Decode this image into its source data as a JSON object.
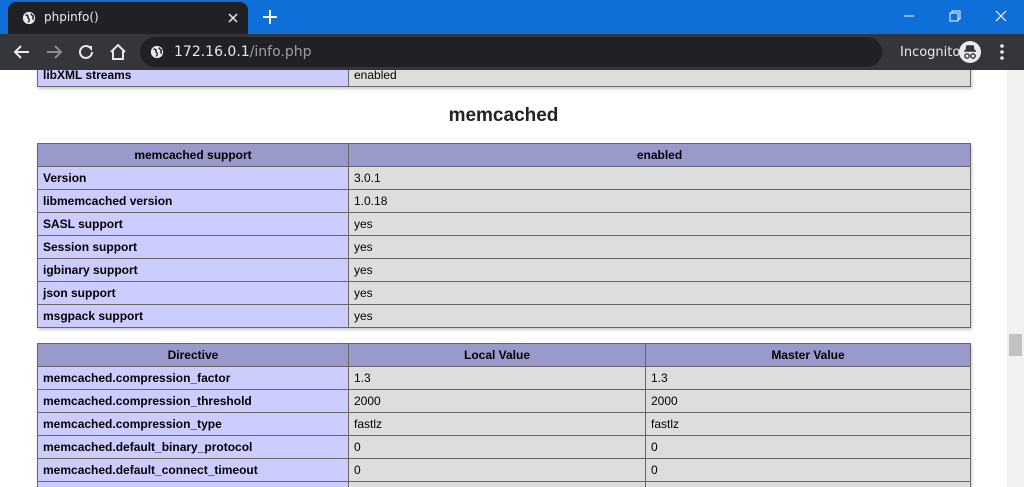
{
  "browser": {
    "tab_title": "phpinfo()",
    "url_host": "172.16.0.1",
    "url_path": "/info.php",
    "incognito_label": "Incognito"
  },
  "top_table": {
    "rows": [
      {
        "key": "libXML streams",
        "value": "enabled"
      }
    ]
  },
  "section_title": "memcached",
  "support_table": {
    "header": {
      "key": "memcached support",
      "value": "enabled"
    },
    "rows": [
      {
        "key": "Version",
        "value": "3.0.1"
      },
      {
        "key": "libmemcached version",
        "value": "1.0.18"
      },
      {
        "key": "SASL support",
        "value": "yes"
      },
      {
        "key": "Session support",
        "value": "yes"
      },
      {
        "key": "igbinary support",
        "value": "yes"
      },
      {
        "key": "json support",
        "value": "yes"
      },
      {
        "key": "msgpack support",
        "value": "yes"
      }
    ]
  },
  "directive_table": {
    "headers": [
      "Directive",
      "Local Value",
      "Master Value"
    ],
    "rows": [
      {
        "directive": "memcached.compression_factor",
        "local": "1.3",
        "master": "1.3"
      },
      {
        "directive": "memcached.compression_threshold",
        "local": "2000",
        "master": "2000"
      },
      {
        "directive": "memcached.compression_type",
        "local": "fastlz",
        "master": "fastlz"
      },
      {
        "directive": "memcached.default_binary_protocol",
        "local": "0",
        "master": "0"
      },
      {
        "directive": "memcached.default_connect_timeout",
        "local": "0",
        "master": "0"
      }
    ]
  }
}
